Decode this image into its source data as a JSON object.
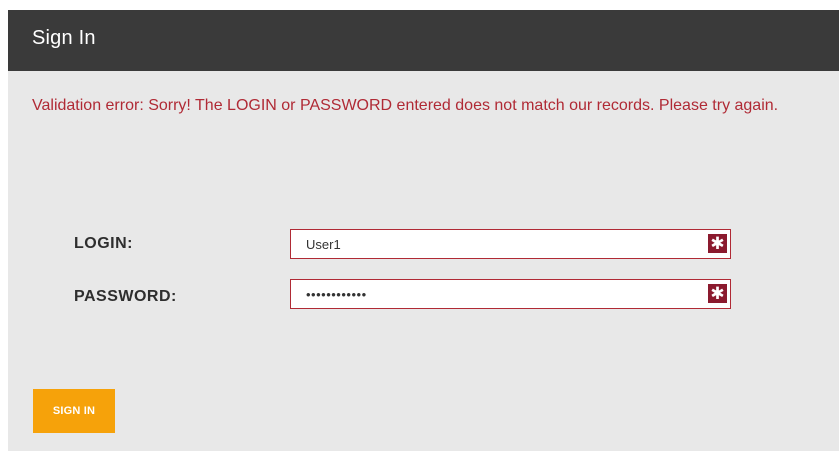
{
  "header": {
    "title": "Sign In"
  },
  "error": {
    "message": "Validation error: Sorry! The LOGIN or PASSWORD entered does not match our records. Please try again."
  },
  "form": {
    "login_label": "LOGIN:",
    "login_value": "User1",
    "password_label": "PASSWORD:",
    "password_value": "••••••••••••",
    "required_symbol": "✱"
  },
  "actions": {
    "signin_label": "SIGN IN"
  },
  "colors": {
    "header_bg": "#3a3a3a",
    "page_bg": "#e8e8e8",
    "error_text": "#b02a35",
    "required_badge": "#8b1a2e",
    "button_bg": "#f6a20a"
  },
  "icons": {
    "required": "required-asterisk-icon"
  }
}
